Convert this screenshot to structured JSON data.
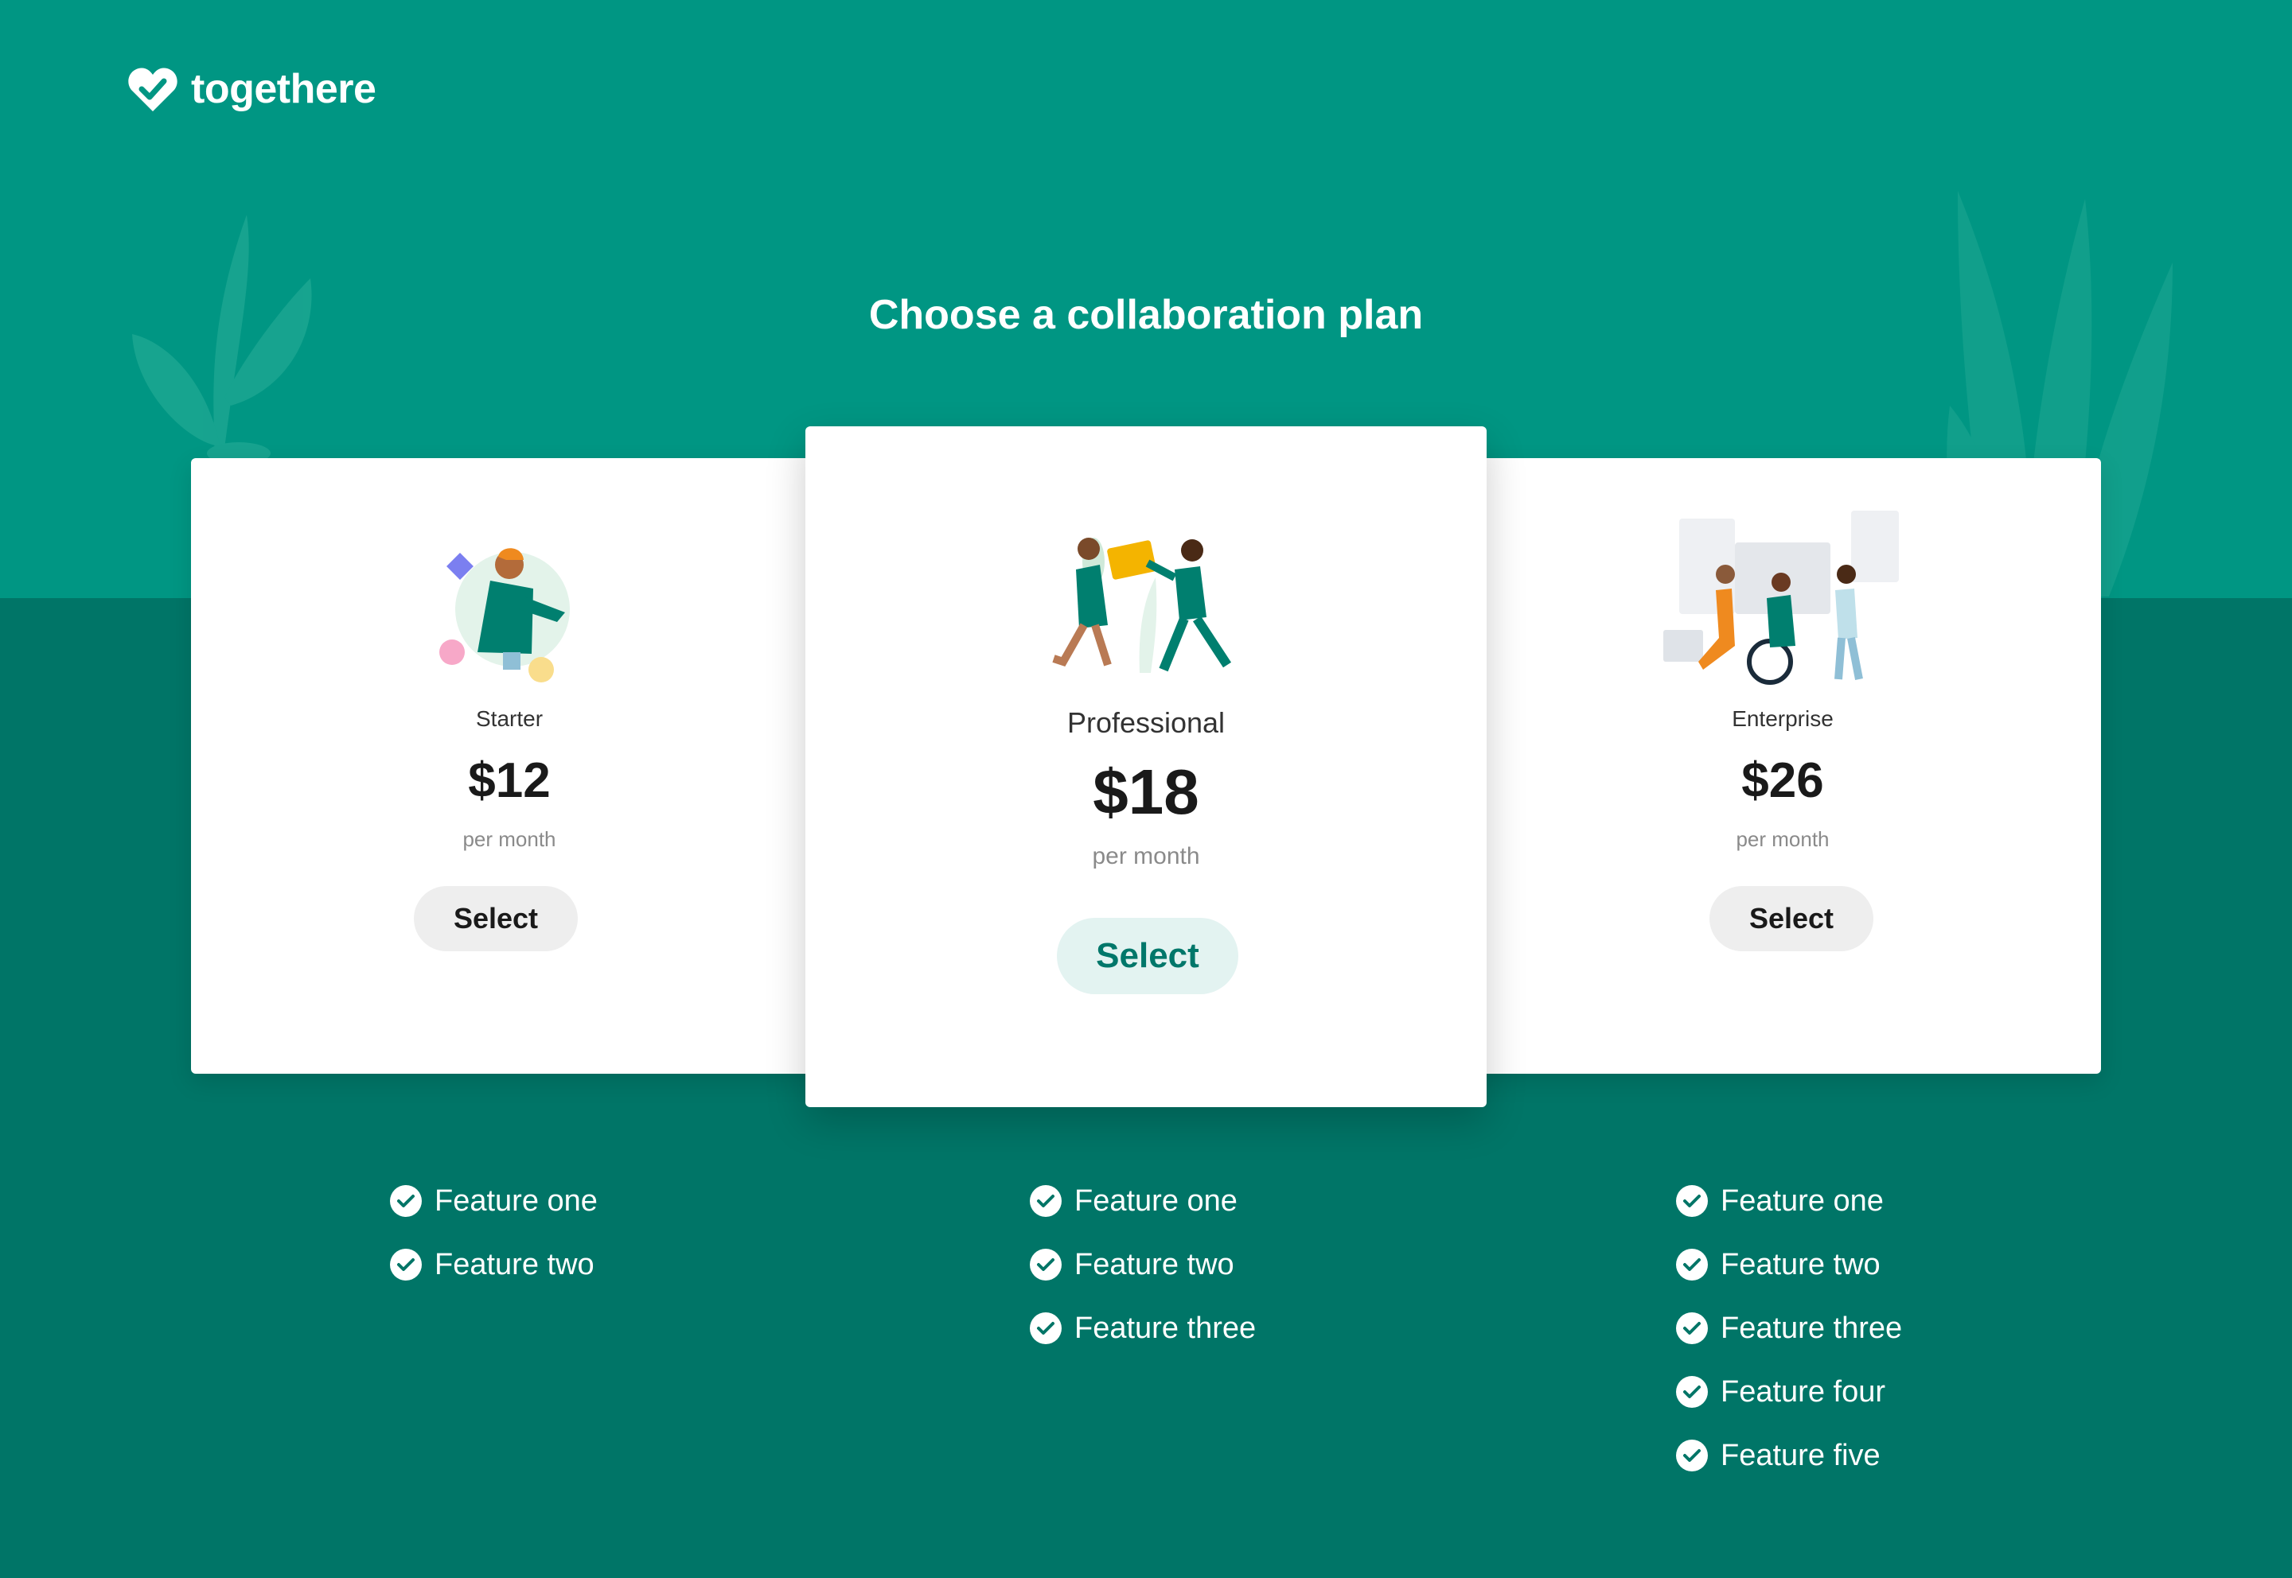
{
  "brand": {
    "name": "togethere",
    "logo_icon": "heart-check-icon"
  },
  "page": {
    "title": "Choose a collaboration plan"
  },
  "colors": {
    "header_bg": "#009683",
    "body_bg": "#007567",
    "accent": "#00776a",
    "accent_light": "#e3f3f1"
  },
  "plans": [
    {
      "name": "Starter",
      "price": "$12",
      "period": "per month",
      "select_label": "Select",
      "features": [
        "Feature one",
        "Feature two"
      ]
    },
    {
      "name": "Professional",
      "price": "$18",
      "period": "per month",
      "select_label": "Select",
      "featured": true,
      "features": [
        "Feature one",
        "Feature two",
        "Feature three"
      ]
    },
    {
      "name": "Enterprise",
      "price": "$26",
      "period": "per month",
      "select_label": "Select",
      "features": [
        "Feature one",
        "Feature two",
        "Feature three",
        "Feature four",
        "Feature five"
      ]
    }
  ]
}
